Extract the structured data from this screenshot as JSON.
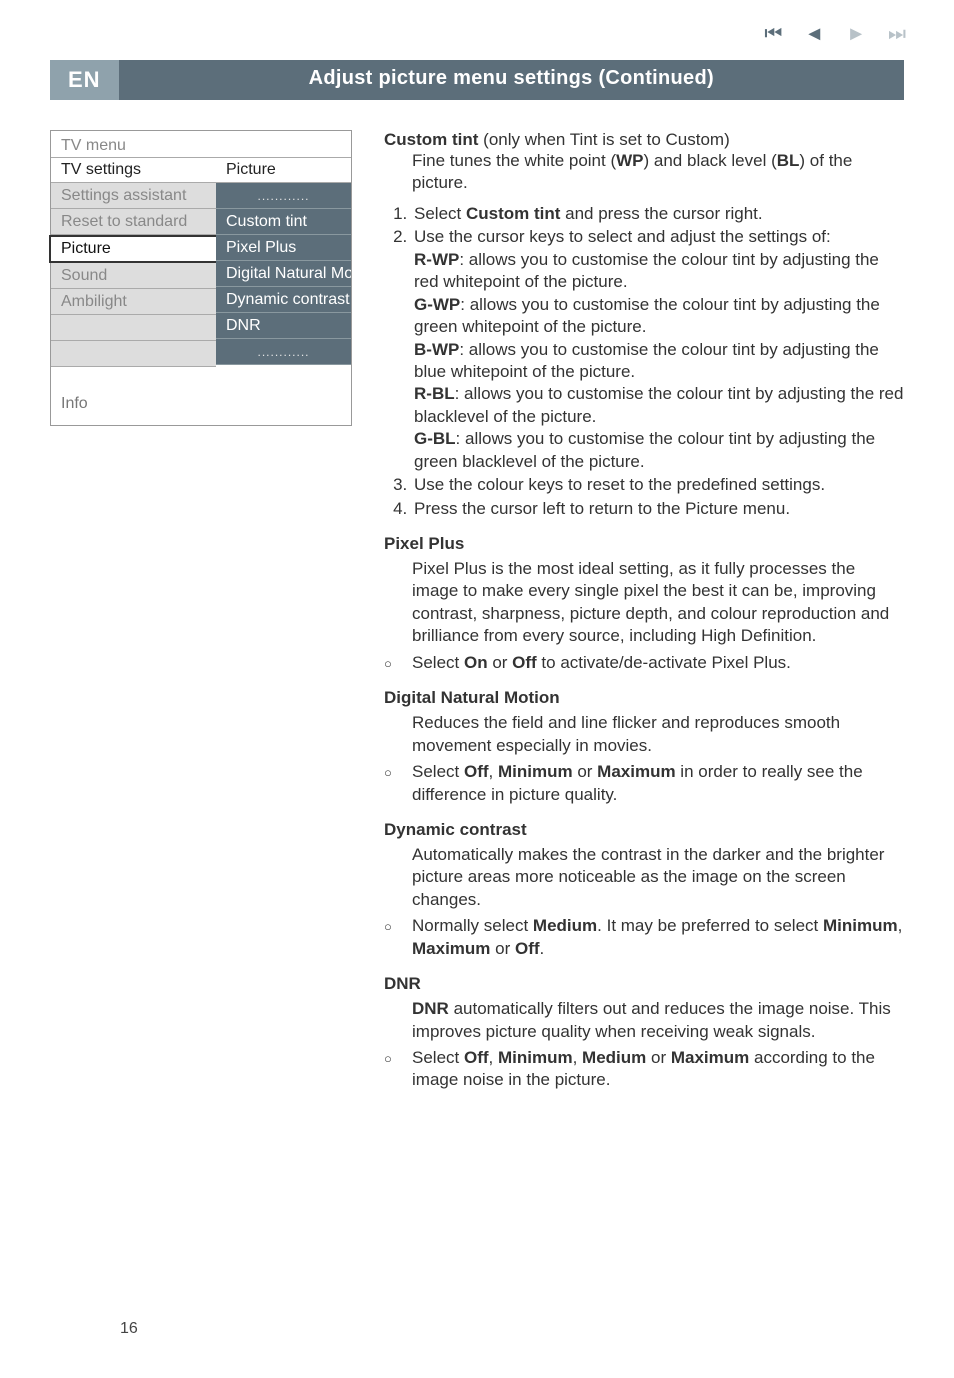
{
  "nav": {
    "first": "⏮",
    "prev": "◄",
    "play": "►",
    "next": "⏭"
  },
  "header": {
    "lang": "EN",
    "title": "Adjust picture menu settings  (Continued)"
  },
  "tvmenu": {
    "title": "TV menu",
    "left": {
      "header": "TV settings",
      "rows": [
        "Settings assistant",
        "Reset to standard",
        "Picture",
        "Sound",
        "Ambilight"
      ]
    },
    "right": {
      "header": "Picture",
      "dots_top": "............",
      "rows": [
        "Custom tint",
        "Pixel Plus",
        "Digital Natural Mo..",
        "Dynamic contrast",
        "DNR"
      ],
      "dots_bottom": "............"
    },
    "info": "Info"
  },
  "body": {
    "custom_tint_title_a": "Custom tint",
    "custom_tint_title_b": "  (only when Tint is set to Custom)",
    "custom_tint_desc_a": "Fine tunes the white point (",
    "custom_tint_desc_b": "WP",
    "custom_tint_desc_c": ") and black level (",
    "custom_tint_desc_d": "BL",
    "custom_tint_desc_e": ") of the picture.",
    "ol1": "Select ",
    "ol1b": "Custom tint",
    "ol1c": " and press the cursor right.",
    "ol2": "Use the cursor keys to select and adjust the settings of:",
    "rwp_a": "R-WP",
    "rwp_b": ": allows you to customise the colour tint by adjusting the red whitepoint of the picture.",
    "gwp_a": "G-WP",
    "gwp_b": ": allows you to customise the colour tint by adjusting the green whitepoint of the picture.",
    "bwp_a": "B-WP",
    "bwp_b": ": allows you to customise the colour tint by adjusting the blue whitepoint of the picture.",
    "rbl_a": "R-BL",
    "rbl_b": ": allows you to customise the colour tint by adjusting the red blacklevel of the picture.",
    "gbl_a": "G-BL",
    "gbl_b": ": allows you to customise the colour tint by adjusting the green blacklevel of the picture.",
    "ol3": "Use the colour keys to reset to the predefined settings.",
    "ol4": "Press the cursor left to return to the Picture menu.",
    "pixel_plus_h": "Pixel Plus",
    "pixel_plus_p": "Pixel Plus is the most ideal setting, as it fully processes the image to make every single pixel the best it can be, improving contrast, sharpness, picture depth, and colour reproduction and brilliance from every source, including High Definition.",
    "pixel_plus_b1a": "Select ",
    "pixel_plus_b1b": "On",
    "pixel_plus_b1c": " or ",
    "pixel_plus_b1d": "Off",
    "pixel_plus_b1e": " to activate/de-activate Pixel Plus.",
    "dnm_h": "Digital Natural Motion",
    "dnm_p": "Reduces the field and line flicker and reproduces smooth movement especially in movies.",
    "dnm_b_a": "Select ",
    "dnm_b_b": "Off",
    "dnm_b_c": ", ",
    "dnm_b_d": "Minimum",
    "dnm_b_e": " or ",
    "dnm_b_f": "Maximum",
    "dnm_b_g": " in order to really see the difference in picture quality.",
    "dc_h": "Dynamic contrast",
    "dc_p": "Automatically makes the contrast in the darker and the brighter picture areas more noticeable as the image on the screen changes.",
    "dc_b_a": "Normally select ",
    "dc_b_b": "Medium",
    "dc_b_c": ". It may be preferred to select ",
    "dc_b_d": "Minimum",
    "dc_b_e": ", ",
    "dc_b_f": "Maximum",
    "dc_b_g": " or ",
    "dc_b_h": "Off",
    "dc_b_i": ".",
    "dnr_h": "DNR",
    "dnr_p_a": "DNR",
    "dnr_p_b": " automatically filters out and reduces the image noise. This improves picture quality when receiving weak signals.",
    "dnr_b_a": "Select ",
    "dnr_b_b": "Off",
    "dnr_b_c": ", ",
    "dnr_b_d": "Minimum",
    "dnr_b_e": ", ",
    "dnr_b_f": "Medium",
    "dnr_b_g": " or ",
    "dnr_b_h": "Maximum",
    "dnr_b_i": " according to the image noise in the picture."
  },
  "pagenum": "16"
}
